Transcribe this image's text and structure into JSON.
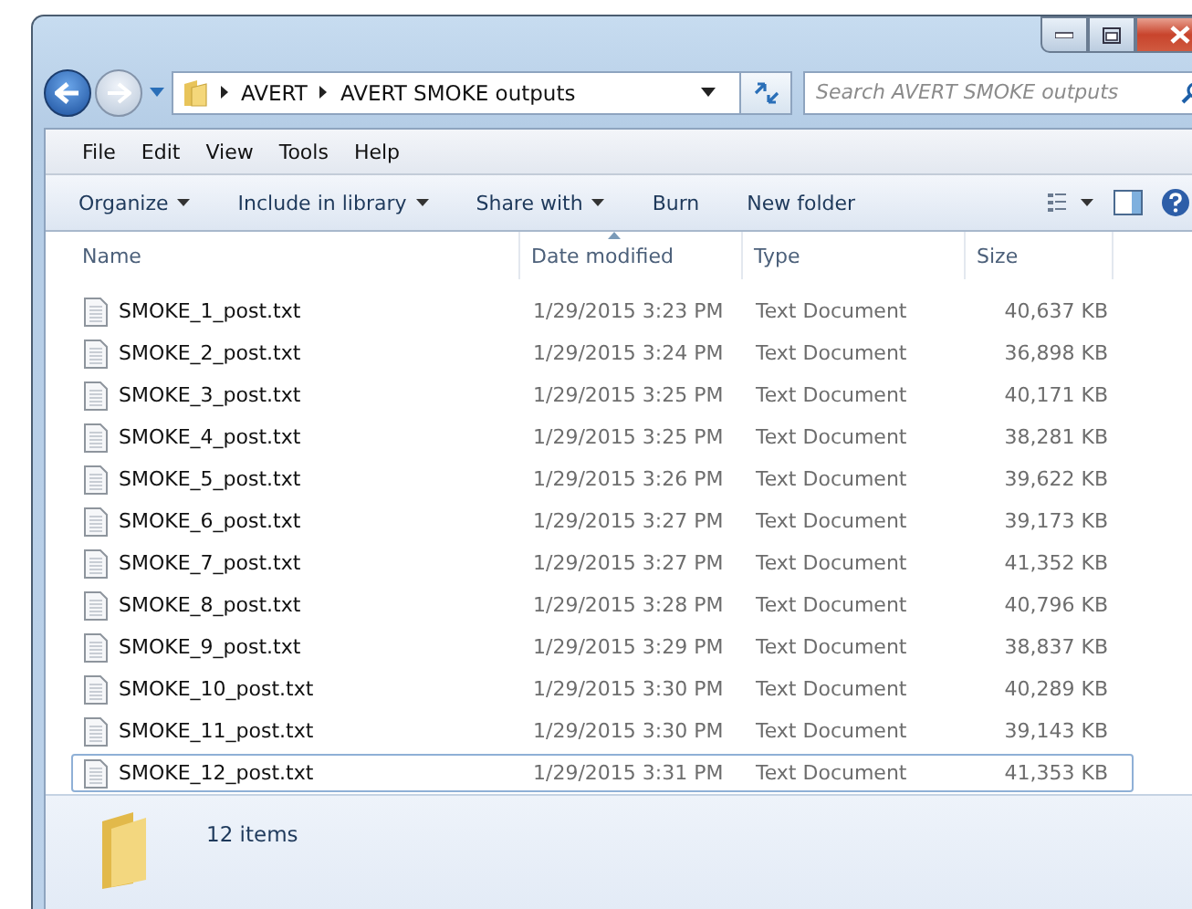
{
  "address_bar": {
    "path": [
      "AVERT",
      "AVERT SMOKE outputs"
    ]
  },
  "search": {
    "placeholder": "Search AVERT SMOKE outputs"
  },
  "menu_bar": [
    "File",
    "Edit",
    "View",
    "Tools",
    "Help"
  ],
  "command_bar": [
    {
      "label": "Organize",
      "dropdown": true
    },
    {
      "label": "Include in library",
      "dropdown": true
    },
    {
      "label": "Share with",
      "dropdown": true
    },
    {
      "label": "Burn",
      "dropdown": false
    },
    {
      "label": "New folder",
      "dropdown": false
    }
  ],
  "table": {
    "columns": [
      {
        "label": "Name",
        "sorted": false
      },
      {
        "label": "Date modified",
        "sorted": true
      },
      {
        "label": "Type",
        "sorted": false
      },
      {
        "label": "Size",
        "sorted": false
      }
    ],
    "rows": [
      {
        "name": "SMOKE_1_post.txt",
        "date": "1/29/2015 3:23 PM",
        "type": "Text Document",
        "size": "40,637 KB",
        "focused": false
      },
      {
        "name": "SMOKE_2_post.txt",
        "date": "1/29/2015 3:24 PM",
        "type": "Text Document",
        "size": "36,898 KB",
        "focused": false
      },
      {
        "name": "SMOKE_3_post.txt",
        "date": "1/29/2015 3:25 PM",
        "type": "Text Document",
        "size": "40,171 KB",
        "focused": false
      },
      {
        "name": "SMOKE_4_post.txt",
        "date": "1/29/2015 3:25 PM",
        "type": "Text Document",
        "size": "38,281 KB",
        "focused": false
      },
      {
        "name": "SMOKE_5_post.txt",
        "date": "1/29/2015 3:26 PM",
        "type": "Text Document",
        "size": "39,622 KB",
        "focused": false
      },
      {
        "name": "SMOKE_6_post.txt",
        "date": "1/29/2015 3:27 PM",
        "type": "Text Document",
        "size": "39,173 KB",
        "focused": false
      },
      {
        "name": "SMOKE_7_post.txt",
        "date": "1/29/2015 3:27 PM",
        "type": "Text Document",
        "size": "41,352 KB",
        "focused": false
      },
      {
        "name": "SMOKE_8_post.txt",
        "date": "1/29/2015 3:28 PM",
        "type": "Text Document",
        "size": "40,796 KB",
        "focused": false
      },
      {
        "name": "SMOKE_9_post.txt",
        "date": "1/29/2015 3:29 PM",
        "type": "Text Document",
        "size": "38,837 KB",
        "focused": false
      },
      {
        "name": "SMOKE_10_post.txt",
        "date": "1/29/2015 3:30 PM",
        "type": "Text Document",
        "size": "40,289 KB",
        "focused": false
      },
      {
        "name": "SMOKE_11_post.txt",
        "date": "1/29/2015 3:30 PM",
        "type": "Text Document",
        "size": "39,143 KB",
        "focused": false
      },
      {
        "name": "SMOKE_12_post.txt",
        "date": "1/29/2015 3:31 PM",
        "type": "Text Document",
        "size": "41,353 KB",
        "focused": true
      }
    ]
  },
  "status_bar": {
    "item_count": "12 items"
  }
}
